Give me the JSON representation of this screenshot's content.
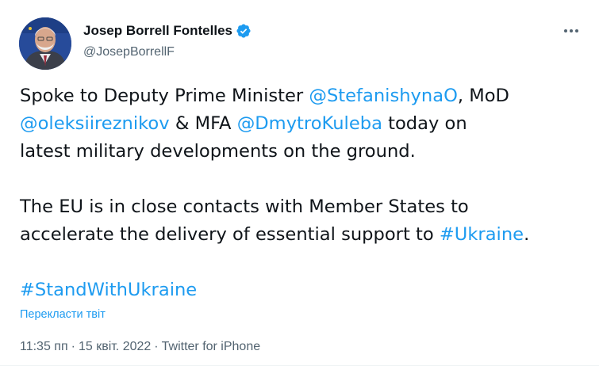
{
  "author": {
    "name": "Josep Borrell Fontelles",
    "handle": "@JosepBorrellF",
    "verified": true,
    "accent_color": "#1d9bf0"
  },
  "tweet": {
    "line1_prefix": "Spoke to Deputy Prime Minister ",
    "mention1": "@StefanishynaO",
    "line1_suffix": ", MoD",
    "mention2": "@oleksiireznikov",
    "line2_mid": " & MFA ",
    "mention3": "@DmytroKuleba",
    "line2_suffix": " today on",
    "line3": "latest military developments on the ground.",
    "line4": "The EU is in close contacts with Member States to",
    "line5_prefix": "accelerate the delivery of essential support to ",
    "hashtag1": "#Ukraine",
    "line5_suffix": ".",
    "hashtag2": "#StandWithUkraine"
  },
  "translate_label": "Перекласти твіт",
  "meta": {
    "time": "11:35 пп",
    "date": "15 квіт. 2022",
    "source": "Twitter for iPhone",
    "separator": "·"
  },
  "icons": {
    "verified": "verified-badge-icon",
    "more": "more-options-icon"
  }
}
